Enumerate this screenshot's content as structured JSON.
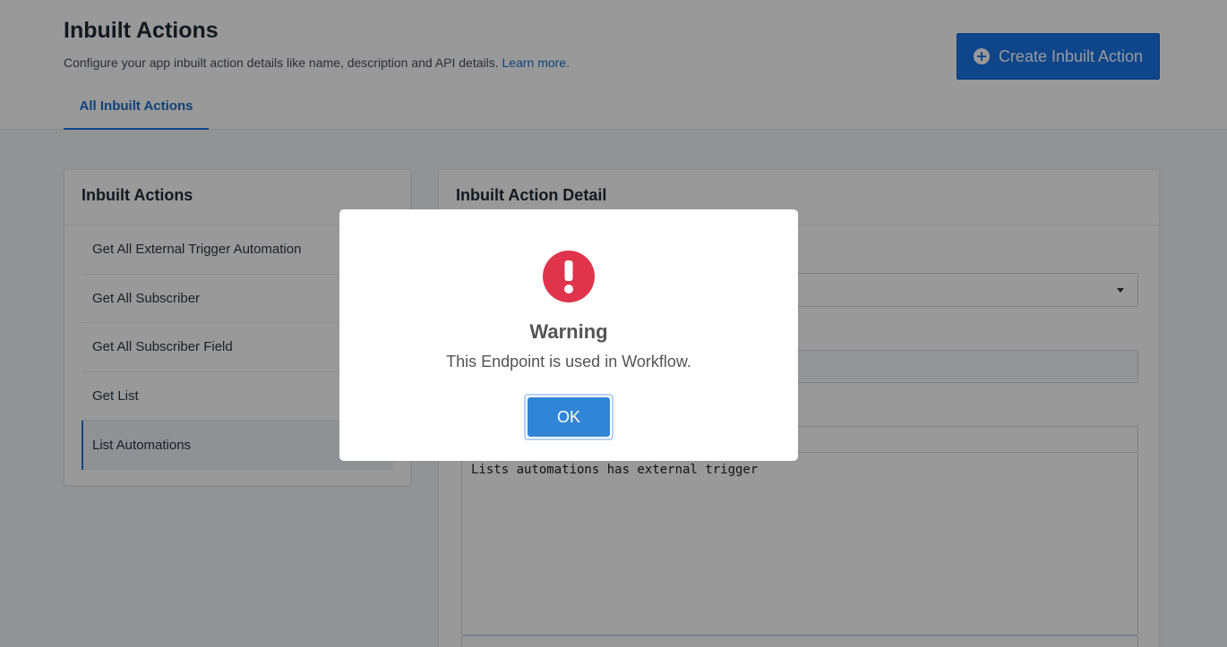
{
  "header": {
    "title": "Inbuilt Actions",
    "subtitle": "Configure your app inbuilt action details like name, description and API details.",
    "learn_more": "Learn more.",
    "create_button": "Create Inbuilt Action",
    "tab_label": "All Inbuilt Actions"
  },
  "sidebar": {
    "title": "Inbuilt Actions",
    "items": [
      {
        "label": "Get All External Trigger Automation"
      },
      {
        "label": "Get All Subscriber"
      },
      {
        "label": "Get All Subscriber Field"
      },
      {
        "label": "Get List"
      },
      {
        "label": "List Automations"
      }
    ],
    "active_index": 4
  },
  "detail": {
    "title": "Inbuilt Action Detail",
    "description": "Lists automations has external trigger"
  },
  "modal": {
    "icon": "exclamation-icon",
    "title": "Warning",
    "text": "This Endpoint is used in Workflow.",
    "ok_label": "OK"
  },
  "colors": {
    "primary": "#1a73e8",
    "warning_red": "#e0344c",
    "ok_button": "#3085d6"
  }
}
